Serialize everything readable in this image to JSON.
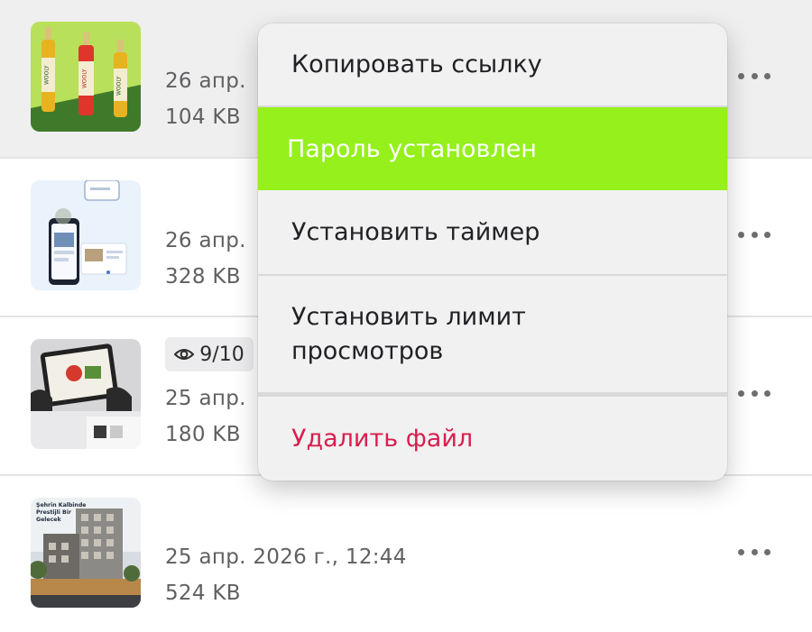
{
  "files": [
    {
      "date": "26 апр.",
      "size": "104 KB"
    },
    {
      "date": "26 апр.",
      "size": "328 KB"
    },
    {
      "date": "25 апр.",
      "size": "180 KB",
      "views": "9/10"
    },
    {
      "date": "25 апр. 2026 г., 12:44",
      "size": "524 KB",
      "thumb_caption": [
        "Şehrin Kalbinde",
        "Prestijli Bir",
        "Gelecek"
      ]
    }
  ],
  "thumb_bottle_label": "WOOLY",
  "context_menu": {
    "copy_link": "Копировать ссылку",
    "password_set": "Пароль установлен",
    "set_timer": "Установить таймер",
    "set_view_limit_line1": "Установить лимит",
    "set_view_limit_line2": "просмотров",
    "delete_file": "Удалить файл"
  },
  "colors": {
    "highlight": "#95f01c",
    "danger": "#d81e4d"
  },
  "icons": {
    "more": "more-horizontal-icon",
    "views": "eye-icon"
  }
}
